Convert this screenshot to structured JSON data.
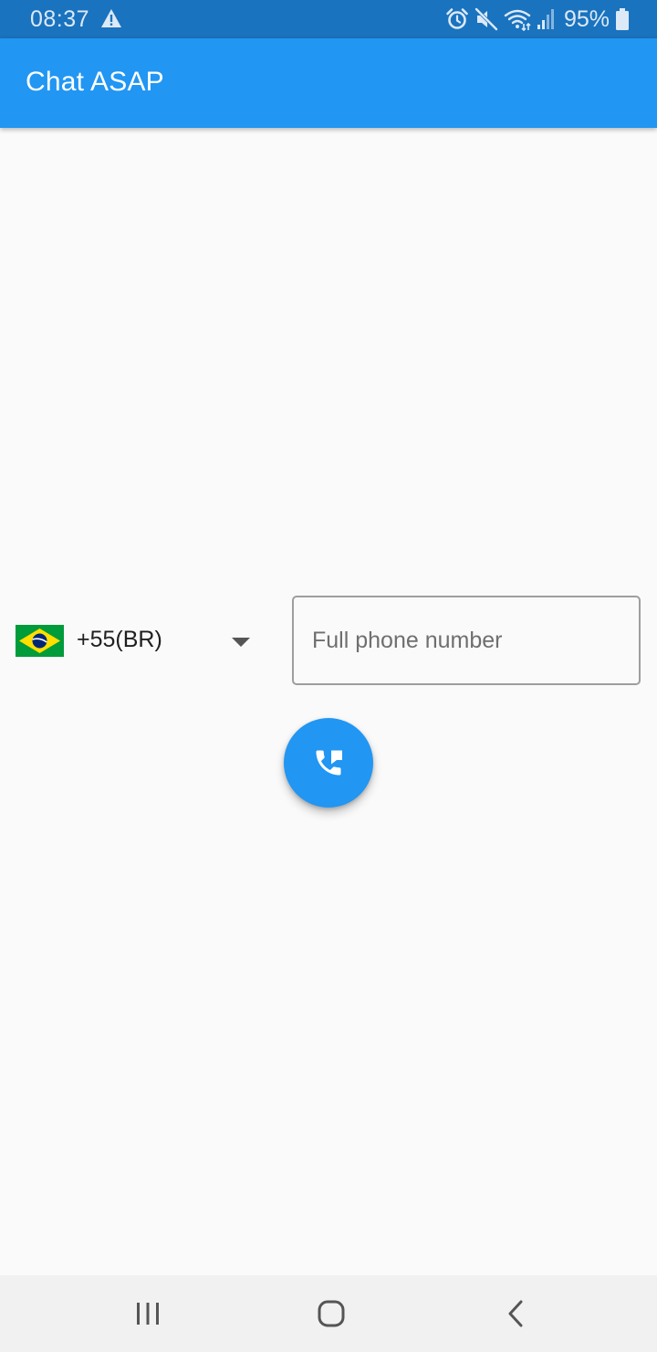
{
  "status_bar": {
    "time": "08:37",
    "battery": "95%",
    "icons": [
      "warning-icon",
      "alarm-icon",
      "mute-icon",
      "wifi-icon",
      "signal-icon",
      "battery-icon"
    ]
  },
  "app_bar": {
    "title": "Chat ASAP"
  },
  "country_picker": {
    "flag_icon": "brazil-flag-icon",
    "selected": "+55(BR)"
  },
  "phone_field": {
    "value": "",
    "placeholder": "Full phone number"
  },
  "call_button": {
    "icon": "phone-forward-icon"
  },
  "nav_bar": {
    "items": [
      "recent-apps-icon",
      "home-icon",
      "back-icon"
    ]
  },
  "colors": {
    "primary": "#2196f3",
    "status_bar": "#1a73be",
    "background": "#fafafa",
    "nav_bar": "#f1f1f1"
  }
}
